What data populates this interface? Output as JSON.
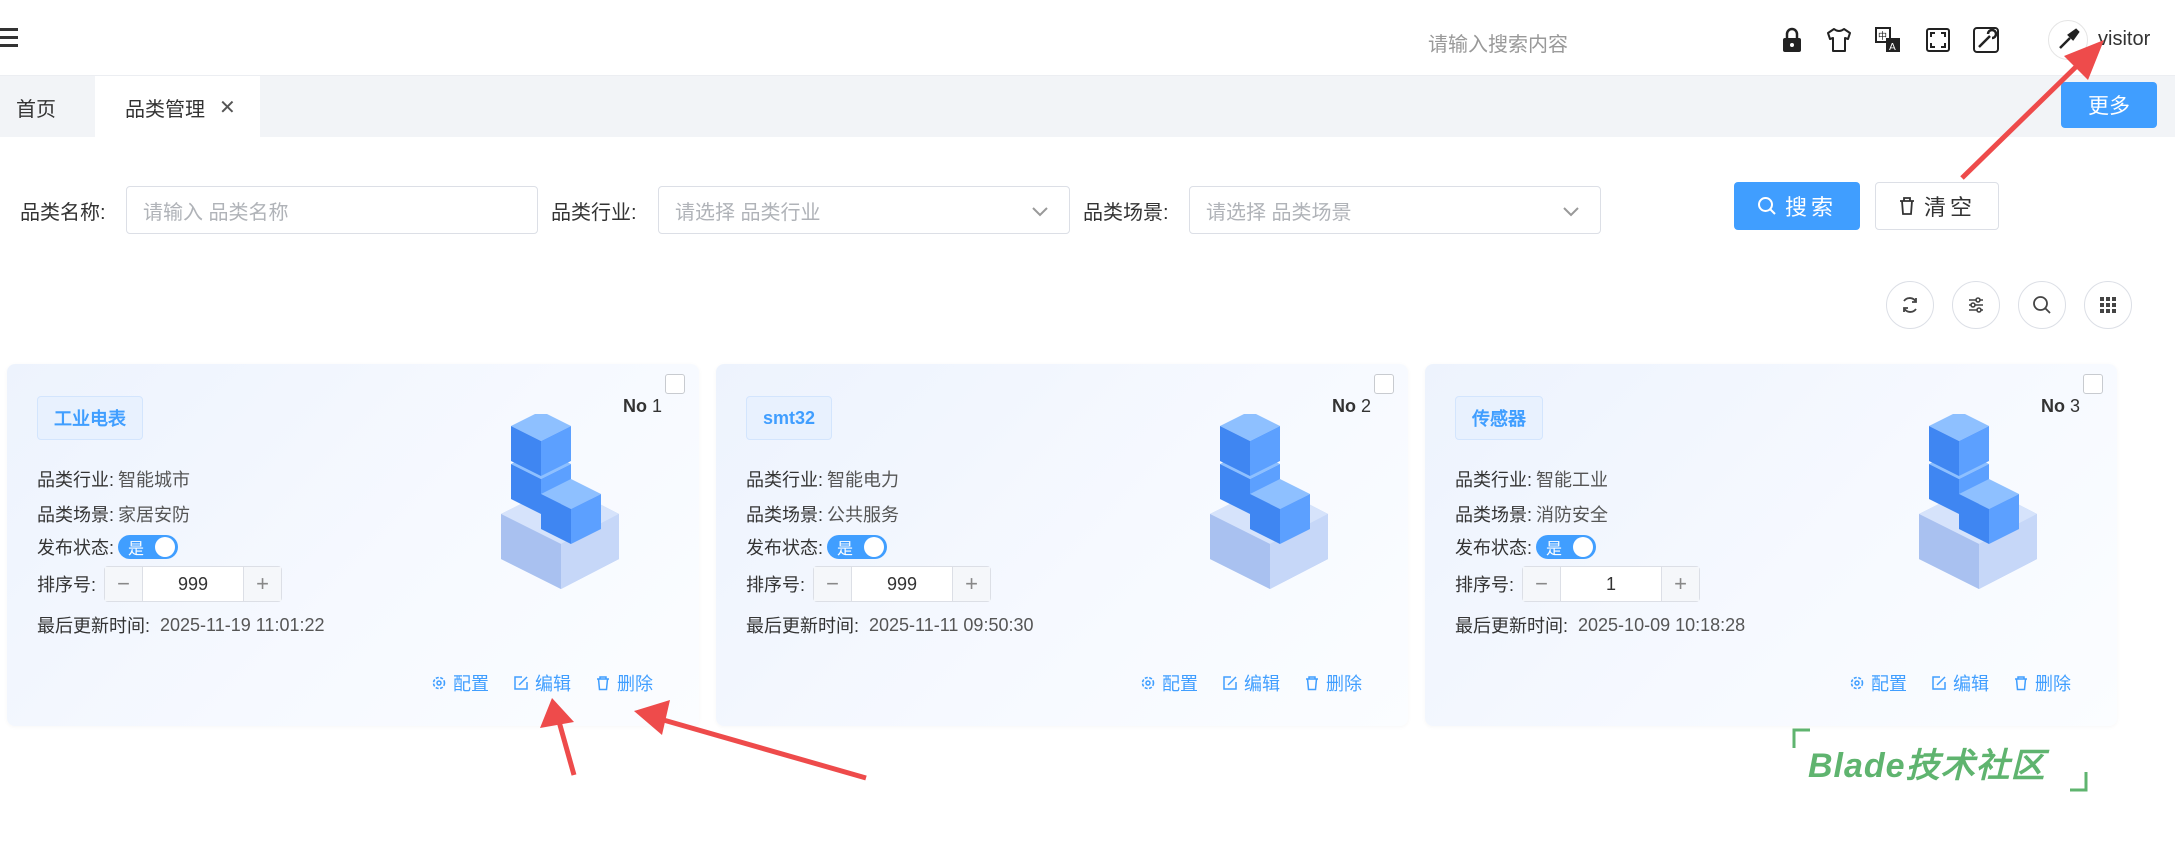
{
  "header": {
    "search_placeholder": "请输入搜索内容",
    "username": "visitor",
    "tools": [
      "lock-icon",
      "shirt-icon",
      "translate-icon",
      "fullscreen-icon",
      "settings-icon"
    ]
  },
  "tabs": {
    "home": "首页",
    "active": "品类管理",
    "close": "✕",
    "more": "更多"
  },
  "filters": {
    "name_label": "品类名称:",
    "name_placeholder": "请输入 品类名称",
    "industry_label": "品类行业:",
    "industry_placeholder": "请选择 品类行业",
    "scene_label": "品类场景:",
    "scene_placeholder": "请选择 品类场景",
    "search_btn": "搜索",
    "clear_btn": "清空"
  },
  "toolbar_icons": [
    "refresh-icon",
    "filter-icon",
    "search-icon",
    "grid-icon"
  ],
  "card_labels": {
    "industry": "品类行业:",
    "scene": "品类场景:",
    "status": "发布状态:",
    "sort": "排序号:",
    "updated": "最后更新时间:",
    "no": "No",
    "switch_on": "是",
    "config": "配置",
    "edit": "编辑",
    "delete": "删除"
  },
  "cards": [
    {
      "tag": "工业电表",
      "no": "1",
      "industry": "智能城市",
      "scene": "家居安防",
      "sort": "999",
      "updated": "2025-11-19 11:01:22"
    },
    {
      "tag": "smt32",
      "no": "2",
      "industry": "智能电力",
      "scene": "公共服务",
      "sort": "999",
      "updated": "2025-11-11 09:50:30"
    },
    {
      "tag": "传感器",
      "no": "3",
      "industry": "智能工业",
      "scene": "消防安全",
      "sort": "1",
      "updated": "2025-10-09 10:18:28"
    }
  ],
  "watermark": "Blade技术社区",
  "colors": {
    "primary": "#409eff",
    "annotation": "#ee4b4b",
    "watermark": "#5fb46f"
  }
}
